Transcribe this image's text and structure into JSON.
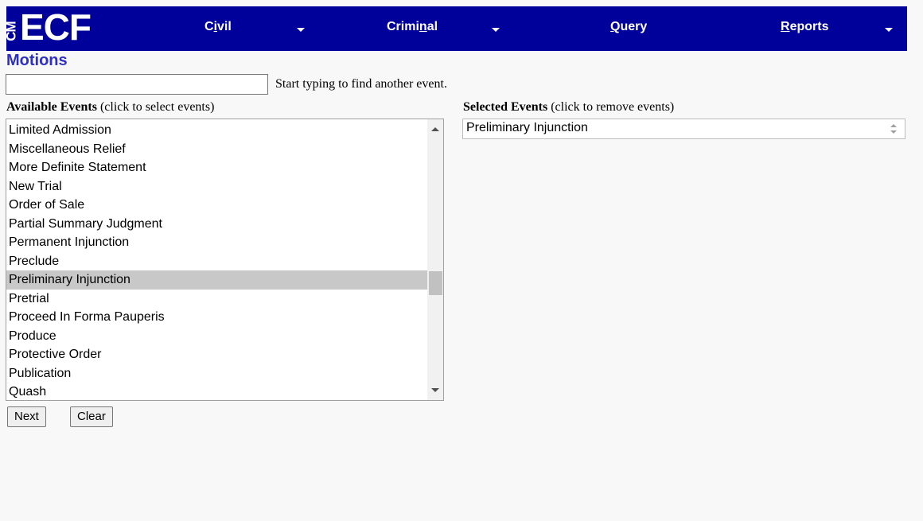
{
  "logo": {
    "cm": "CM",
    "ecf": "ECF"
  },
  "nav": {
    "civil": {
      "pre": "C",
      "acc": "i",
      "post": "vil"
    },
    "criminal": {
      "pre": "Crimi",
      "acc": "n",
      "post": "al"
    },
    "query": {
      "pre": "",
      "acc": "Q",
      "post": "uery"
    },
    "reports": {
      "pre": "",
      "acc": "R",
      "post": "eports"
    }
  },
  "page": {
    "title": "Motions"
  },
  "search": {
    "value": "",
    "placeholder": "",
    "hint": "Start typing to find another event."
  },
  "available": {
    "caption_bold": "Available Events",
    "caption_note": " (click to select events)",
    "items": [
      "Limited Admission",
      "Miscellaneous Relief",
      "More Definite Statement",
      "New Trial",
      "Order of Sale",
      "Partial Summary Judgment",
      "Permanent Injunction",
      "Preclude",
      "Preliminary Injunction",
      "Pretrial",
      "Proceed In Forma Pauperis",
      "Produce",
      "Protective Order",
      "Publication",
      "Quash"
    ],
    "highlighted": "Preliminary Injunction"
  },
  "selected": {
    "caption_bold": "Selected Events",
    "caption_note": " (click to remove events)",
    "items": [
      "Preliminary Injunction"
    ]
  },
  "buttons": {
    "next": "Next",
    "clear": "Clear"
  },
  "colors": {
    "nav_bg": "#00009a",
    "title": "#2d2fc7",
    "highlight": "#c8c8c8"
  },
  "icons": [
    "caret-down-icon",
    "scroll-up-arrow-icon",
    "scroll-down-arrow-icon",
    "spinner-icon"
  ]
}
